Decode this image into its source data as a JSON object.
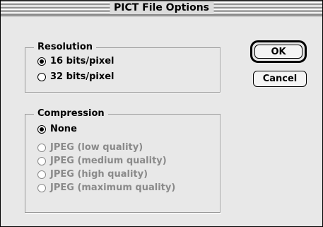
{
  "window": {
    "title": "PICT File Options"
  },
  "resolution": {
    "label": "Resolution",
    "options": [
      {
        "label": "16 bits/pixel",
        "selected": true,
        "enabled": true
      },
      {
        "label": "32 bits/pixel",
        "selected": false,
        "enabled": true
      }
    ]
  },
  "compression": {
    "label": "Compression",
    "options": [
      {
        "label": "None",
        "selected": true,
        "enabled": true
      },
      {
        "label": "JPEG (low quality)",
        "selected": false,
        "enabled": false
      },
      {
        "label": "JPEG (medium quality)",
        "selected": false,
        "enabled": false
      },
      {
        "label": "JPEG (high quality)",
        "selected": false,
        "enabled": false
      },
      {
        "label": "JPEG (maximum quality)",
        "selected": false,
        "enabled": false
      }
    ]
  },
  "buttons": {
    "ok_label": "OK",
    "cancel_label": "Cancel",
    "default": "OK"
  }
}
